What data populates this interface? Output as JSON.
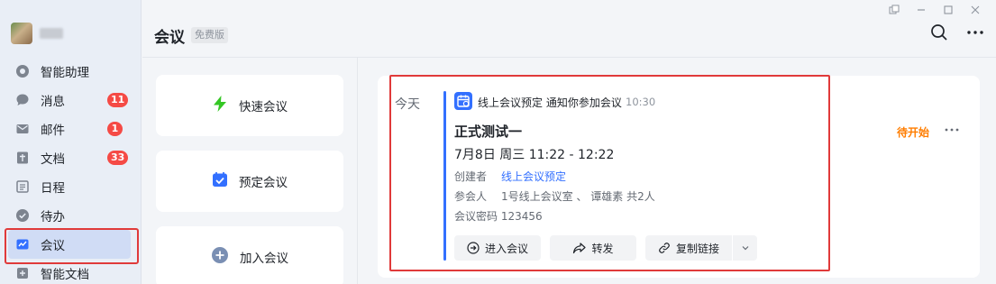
{
  "window": {
    "controls": [
      "pin",
      "minimize",
      "maximize",
      "close"
    ]
  },
  "sidebar": {
    "items": [
      {
        "label": "智能助理",
        "icon": "assistant-icon"
      },
      {
        "label": "消息",
        "icon": "message-icon",
        "badge": "11"
      },
      {
        "label": "邮件",
        "icon": "mail-icon",
        "badge": "1"
      },
      {
        "label": "文档",
        "icon": "docs-icon",
        "badge": "33"
      },
      {
        "label": "日程",
        "icon": "calendar-icon"
      },
      {
        "label": "待办",
        "icon": "todo-icon"
      },
      {
        "label": "会议",
        "icon": "meeting-icon",
        "active": true
      },
      {
        "label": "智能文档",
        "icon": "smart-doc-icon"
      }
    ]
  },
  "header": {
    "title": "会议",
    "tag": "免费版"
  },
  "actions": [
    {
      "label": "快速会议",
      "icon": "lightning-icon",
      "color": "#34c724"
    },
    {
      "label": "预定会议",
      "icon": "calendar-check-icon",
      "color": "#3370ff"
    },
    {
      "label": "加入会议",
      "icon": "plus-circle-icon",
      "color": "#7a8fb3"
    }
  ],
  "meeting": {
    "day": "今天",
    "notify": "线上会议预定 通知你参加会议",
    "notify_time": "10:30",
    "title": "正式测试一",
    "time": "7月8日 周三 11:22 - 12:22",
    "creator_label": "创建者",
    "creator": "线上会议预定",
    "attendees_label": "参会人",
    "attendees": "1号线上会议室 、 谭雄素  共2人",
    "password": "会议密码 123456",
    "status": "待开始",
    "buttons": {
      "enter": "进入会议",
      "forward": "转发",
      "copy": "复制链接"
    }
  },
  "colors": {
    "accent": "#3370ff",
    "badge": "#f54a45",
    "status": "#ff7d00",
    "highlight": "#e03a3a"
  }
}
